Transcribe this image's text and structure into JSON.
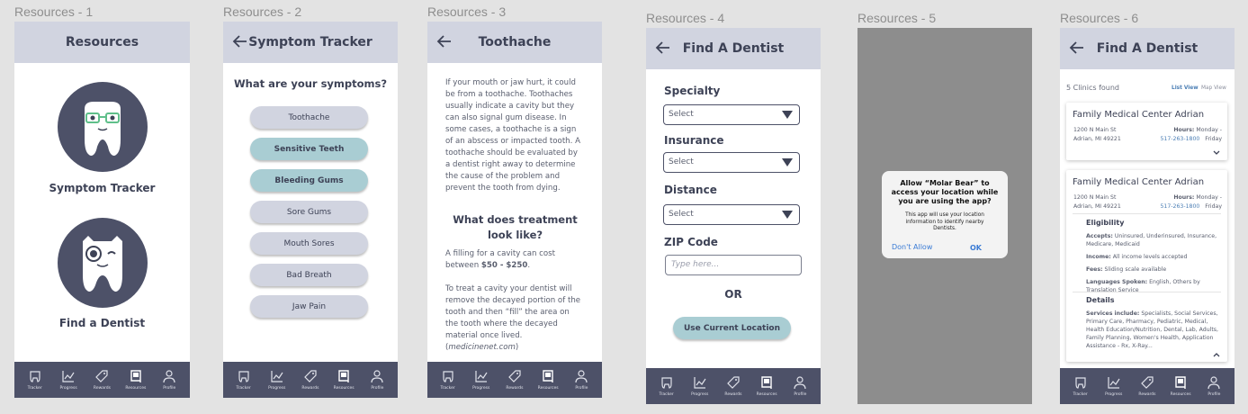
{
  "frames": [
    {
      "label": "Resources - 1"
    },
    {
      "label": "Resources - 2"
    },
    {
      "label": "Resources - 3"
    },
    {
      "label": "Resources - 4"
    },
    {
      "label": "Resources - 5"
    },
    {
      "label": "Resources - 6"
    }
  ],
  "tabbar": [
    "Tracker",
    "Progress",
    "Rewards",
    "Resources",
    "Profile"
  ],
  "s1": {
    "title": "Resources",
    "item1": "Symptom Tracker",
    "item2": "Find a Dentist"
  },
  "s2": {
    "title": "Symptom Tracker",
    "question": "What are your symptoms?",
    "symptoms": [
      {
        "label": "Toothache",
        "selected": false
      },
      {
        "label": "Sensitive Teeth",
        "selected": true
      },
      {
        "label": "Bleeding Gums",
        "selected": true
      },
      {
        "label": "Sore Gums",
        "selected": false
      },
      {
        "label": "Mouth Sores",
        "selected": false
      },
      {
        "label": "Bad Breath",
        "selected": false
      },
      {
        "label": "Jaw Pain",
        "selected": false
      }
    ]
  },
  "s3": {
    "title": "Toothache",
    "p1": "If your mouth or jaw hurt, it could be from a toothache. Toothaches usually indicate a cavity but they can also signal gum disease. In some cases, a toothache is a sign of an abscess or impacted tooth. A toothache should be evaluated by a dentist right away to determine the cause of the problem and prevent the tooth from dying.",
    "heading": "What does treatment look like?",
    "p2a": "A filling for a cavity can cost between ",
    "p2b": "$50 - $250",
    "p2c": ".",
    "p3a": "To treat a cavity your dentist will remove the decayed portion of the tooth and then “fill” the area on the tooth where the decayed material once lived. (",
    "p3b": "medicinenet.com",
    "p3c": ")"
  },
  "s4": {
    "title": "Find A Dentist",
    "specialty_label": "Specialty",
    "insurance_label": "Insurance",
    "distance_label": "Distance",
    "select_value": "Select",
    "zip_label": "ZIP Code",
    "zip_placeholder": "Type here...",
    "or": "OR",
    "use_location": "Use Current Location"
  },
  "s5": {
    "alert_title": "Allow “Molar Bear” to access your location while you are using the app?",
    "alert_body": "This app will use your location information to identify nearby Dentists.",
    "deny": "Don't Allow",
    "ok": "OK"
  },
  "s6": {
    "title": "Find A Dentist",
    "count": "5 Clinics found",
    "list_view": "List View",
    "map_view": "Map View",
    "clinic_name": "Family Medical Center Adrian",
    "addr1": "1200 N Main St",
    "addr2": "Adrian, MI 49221",
    "hours_label": "Hours:",
    "hours_day1": "Monday -",
    "hours_day2": "Friday",
    "phone": "517-263-1800",
    "eligibility": "Eligibility",
    "accepts_label": "Accepts:",
    "accepts": "Uninsured, Underinsured, Insurance, Medicare, Medicaid",
    "income_label": "Income:",
    "income": "All income levels accepted",
    "fees_label": "Fees:",
    "fees": "Sliding scale available",
    "lang_label": "Languages Spoken:",
    "lang": "English, Others by Translation Service",
    "details": "Details",
    "services_label": "Services include:",
    "services": "Specialists, Social Services, Primary Care, Pharmacy, Pediatric, Medical, Health Education/Nutrition, Dental, Lab, Adults, Family Planning, Women's Health, Application Assistance - Rx, X-Ray..."
  },
  "colors": {
    "header": "#d1d4e0",
    "tabbar": "#4d5168",
    "selected": "#a9cdd3",
    "link": "#4c7fb5"
  }
}
